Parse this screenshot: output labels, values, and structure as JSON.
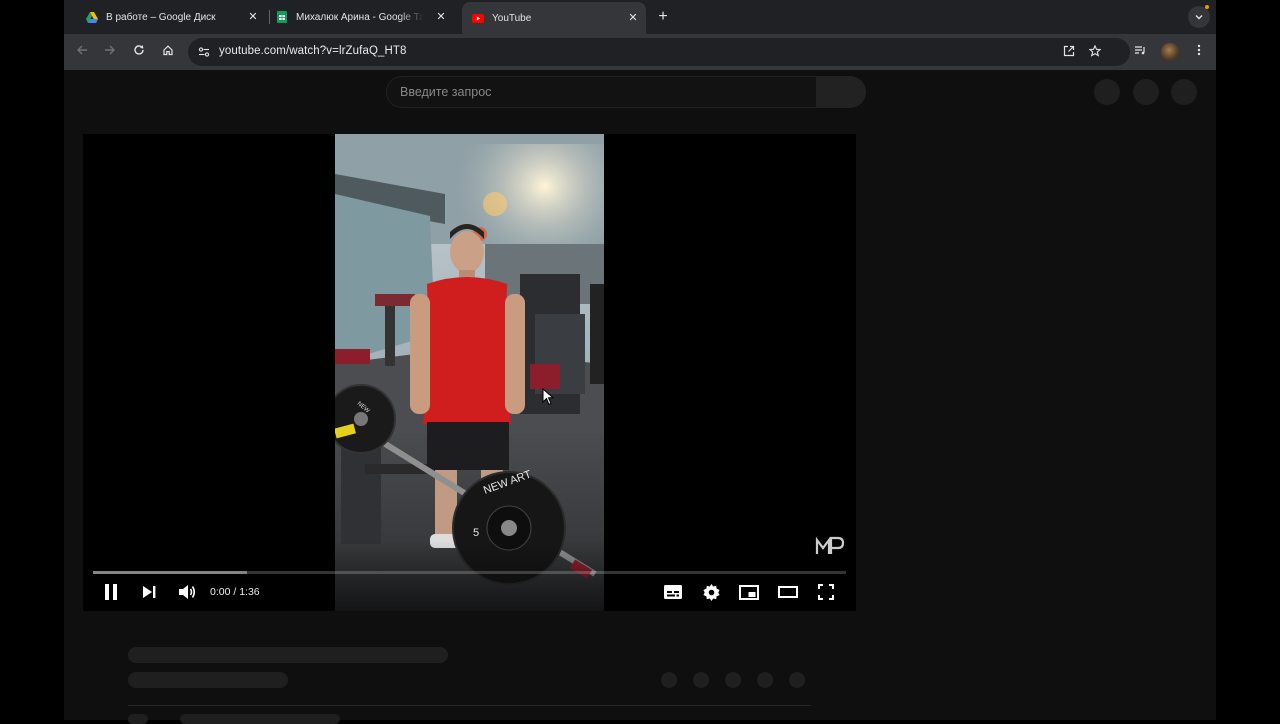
{
  "browser": {
    "tabs": [
      {
        "title": "В работе – Google Диск",
        "icon": "google-drive-icon",
        "active": false
      },
      {
        "title": "Михалюк Арина - Google Таблицы",
        "icon": "google-sheets-icon",
        "active": false
      },
      {
        "title": "YouTube",
        "icon": "youtube-icon",
        "active": true
      }
    ],
    "new_tab_label": "+",
    "url": "youtube.com/watch?v=lrZufaQ_HT8"
  },
  "youtube": {
    "search_placeholder": "Введите запрос",
    "player": {
      "current_time": "0:00",
      "duration": "1:36",
      "time_display": "0:00 / 1:36",
      "buffered_fraction": 0.205,
      "state": "playing",
      "watermark": "MP"
    }
  },
  "colors": {
    "page_bg": "#0f0f0f",
    "tabstrip_bg": "#202124",
    "toolbar_bg": "#35363a",
    "youtube_red": "#ff0000"
  }
}
